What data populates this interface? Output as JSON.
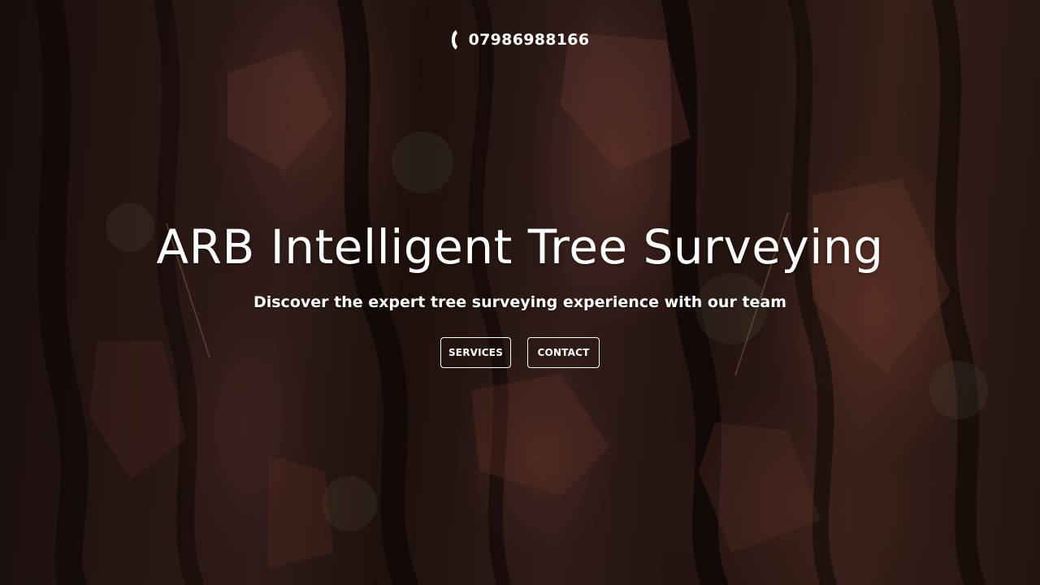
{
  "header": {
    "phone_icon": "phone-icon",
    "phone_number": "07986988166"
  },
  "hero": {
    "title": "ARB Intelligent Tree Surveying",
    "subtitle": "Discover the expert tree surveying experience with our team",
    "buttons": [
      {
        "label": "SERVICES"
      },
      {
        "label": "CONTACT"
      }
    ]
  },
  "colors": {
    "text": "#ffffff",
    "background_dark": "#1b1110",
    "bark_red": "#5a3329"
  }
}
